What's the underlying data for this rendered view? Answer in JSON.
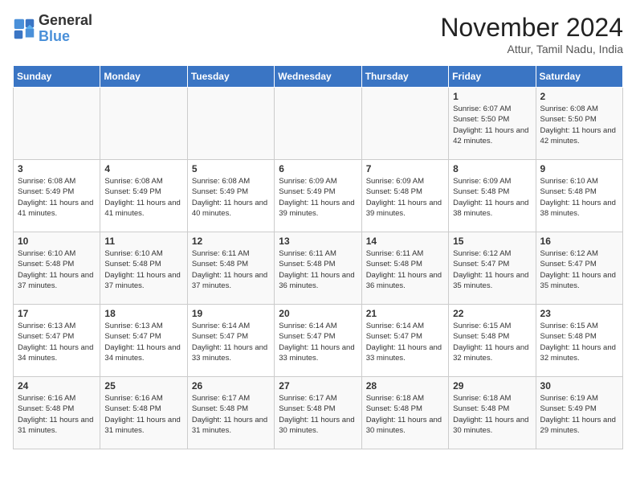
{
  "logo": {
    "text_general": "General",
    "text_blue": "Blue"
  },
  "header": {
    "month": "November 2024",
    "location": "Attur, Tamil Nadu, India"
  },
  "weekdays": [
    "Sunday",
    "Monday",
    "Tuesday",
    "Wednesday",
    "Thursday",
    "Friday",
    "Saturday"
  ],
  "weeks": [
    [
      {
        "day": "",
        "info": ""
      },
      {
        "day": "",
        "info": ""
      },
      {
        "day": "",
        "info": ""
      },
      {
        "day": "",
        "info": ""
      },
      {
        "day": "",
        "info": ""
      },
      {
        "day": "1",
        "info": "Sunrise: 6:07 AM\nSunset: 5:50 PM\nDaylight: 11 hours and 42 minutes."
      },
      {
        "day": "2",
        "info": "Sunrise: 6:08 AM\nSunset: 5:50 PM\nDaylight: 11 hours and 42 minutes."
      }
    ],
    [
      {
        "day": "3",
        "info": "Sunrise: 6:08 AM\nSunset: 5:49 PM\nDaylight: 11 hours and 41 minutes."
      },
      {
        "day": "4",
        "info": "Sunrise: 6:08 AM\nSunset: 5:49 PM\nDaylight: 11 hours and 41 minutes."
      },
      {
        "day": "5",
        "info": "Sunrise: 6:08 AM\nSunset: 5:49 PM\nDaylight: 11 hours and 40 minutes."
      },
      {
        "day": "6",
        "info": "Sunrise: 6:09 AM\nSunset: 5:49 PM\nDaylight: 11 hours and 39 minutes."
      },
      {
        "day": "7",
        "info": "Sunrise: 6:09 AM\nSunset: 5:48 PM\nDaylight: 11 hours and 39 minutes."
      },
      {
        "day": "8",
        "info": "Sunrise: 6:09 AM\nSunset: 5:48 PM\nDaylight: 11 hours and 38 minutes."
      },
      {
        "day": "9",
        "info": "Sunrise: 6:10 AM\nSunset: 5:48 PM\nDaylight: 11 hours and 38 minutes."
      }
    ],
    [
      {
        "day": "10",
        "info": "Sunrise: 6:10 AM\nSunset: 5:48 PM\nDaylight: 11 hours and 37 minutes."
      },
      {
        "day": "11",
        "info": "Sunrise: 6:10 AM\nSunset: 5:48 PM\nDaylight: 11 hours and 37 minutes."
      },
      {
        "day": "12",
        "info": "Sunrise: 6:11 AM\nSunset: 5:48 PM\nDaylight: 11 hours and 37 minutes."
      },
      {
        "day": "13",
        "info": "Sunrise: 6:11 AM\nSunset: 5:48 PM\nDaylight: 11 hours and 36 minutes."
      },
      {
        "day": "14",
        "info": "Sunrise: 6:11 AM\nSunset: 5:48 PM\nDaylight: 11 hours and 36 minutes."
      },
      {
        "day": "15",
        "info": "Sunrise: 6:12 AM\nSunset: 5:47 PM\nDaylight: 11 hours and 35 minutes."
      },
      {
        "day": "16",
        "info": "Sunrise: 6:12 AM\nSunset: 5:47 PM\nDaylight: 11 hours and 35 minutes."
      }
    ],
    [
      {
        "day": "17",
        "info": "Sunrise: 6:13 AM\nSunset: 5:47 PM\nDaylight: 11 hours and 34 minutes."
      },
      {
        "day": "18",
        "info": "Sunrise: 6:13 AM\nSunset: 5:47 PM\nDaylight: 11 hours and 34 minutes."
      },
      {
        "day": "19",
        "info": "Sunrise: 6:14 AM\nSunset: 5:47 PM\nDaylight: 11 hours and 33 minutes."
      },
      {
        "day": "20",
        "info": "Sunrise: 6:14 AM\nSunset: 5:47 PM\nDaylight: 11 hours and 33 minutes."
      },
      {
        "day": "21",
        "info": "Sunrise: 6:14 AM\nSunset: 5:47 PM\nDaylight: 11 hours and 33 minutes."
      },
      {
        "day": "22",
        "info": "Sunrise: 6:15 AM\nSunset: 5:48 PM\nDaylight: 11 hours and 32 minutes."
      },
      {
        "day": "23",
        "info": "Sunrise: 6:15 AM\nSunset: 5:48 PM\nDaylight: 11 hours and 32 minutes."
      }
    ],
    [
      {
        "day": "24",
        "info": "Sunrise: 6:16 AM\nSunset: 5:48 PM\nDaylight: 11 hours and 31 minutes."
      },
      {
        "day": "25",
        "info": "Sunrise: 6:16 AM\nSunset: 5:48 PM\nDaylight: 11 hours and 31 minutes."
      },
      {
        "day": "26",
        "info": "Sunrise: 6:17 AM\nSunset: 5:48 PM\nDaylight: 11 hours and 31 minutes."
      },
      {
        "day": "27",
        "info": "Sunrise: 6:17 AM\nSunset: 5:48 PM\nDaylight: 11 hours and 30 minutes."
      },
      {
        "day": "28",
        "info": "Sunrise: 6:18 AM\nSunset: 5:48 PM\nDaylight: 11 hours and 30 minutes."
      },
      {
        "day": "29",
        "info": "Sunrise: 6:18 AM\nSunset: 5:48 PM\nDaylight: 11 hours and 30 minutes."
      },
      {
        "day": "30",
        "info": "Sunrise: 6:19 AM\nSunset: 5:49 PM\nDaylight: 11 hours and 29 minutes."
      }
    ]
  ]
}
